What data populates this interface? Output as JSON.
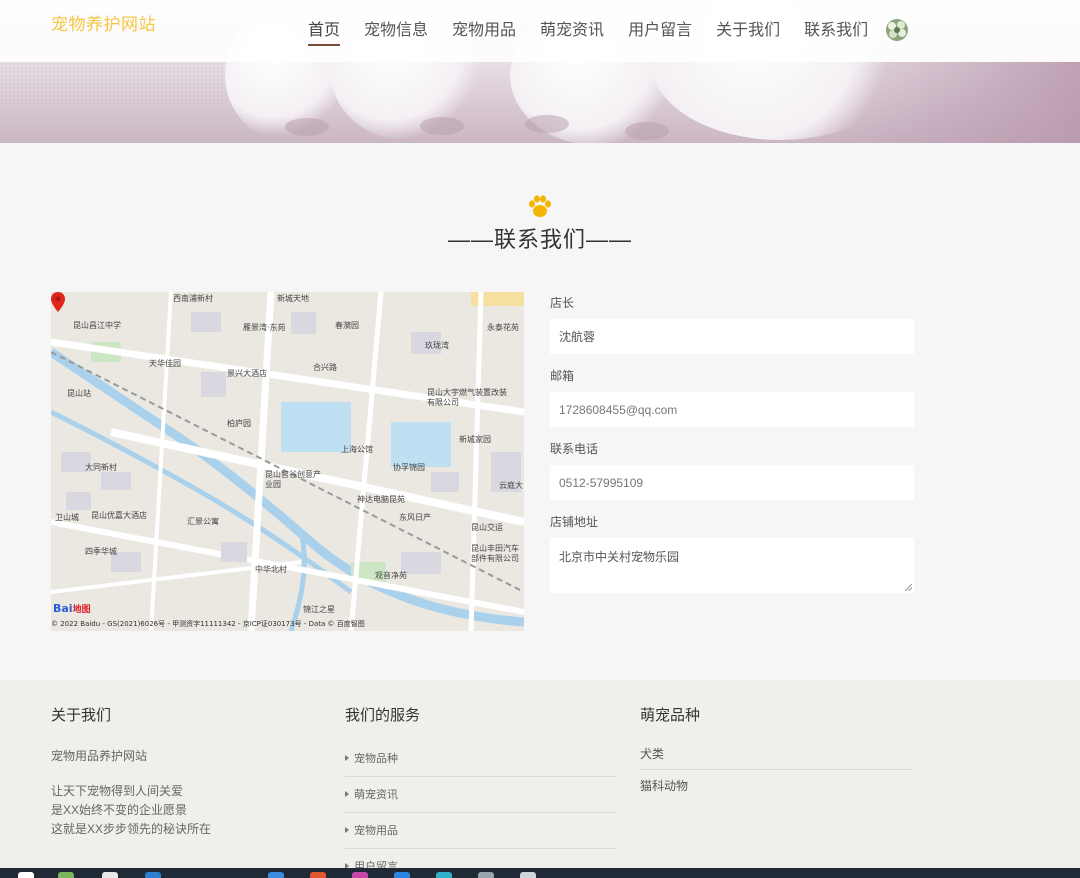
{
  "header": {
    "logo": "宠物养护网站",
    "nav": [
      {
        "label": "首页",
        "active": true
      },
      {
        "label": "宠物信息"
      },
      {
        "label": "宠物用品"
      },
      {
        "label": "萌宠资讯"
      },
      {
        "label": "用户留言"
      },
      {
        "label": "关于我们"
      },
      {
        "label": "联系我们"
      }
    ]
  },
  "section": {
    "title": "——联系我们——"
  },
  "map": {
    "labels": [
      "西南浦新村",
      "新城天地",
      "昆山昌江中学",
      "雁景湾·东苑",
      "春漪园",
      "永泰花苑",
      "玖珑湾",
      "天华佳园",
      "合兴路",
      "景兴大酒店",
      "昆山站",
      "昆山大宇燃气装置改装有限公司",
      "柏庐园",
      "新城家园",
      "上海公馆",
      "大同新村",
      "协孚锦园",
      "昆山智谷创意产业园",
      "神达电脑昆苑",
      "云庭大",
      "昆山优嘉大酒店",
      "汇景公寓",
      "东风日产",
      "昆山交运",
      "卫山城",
      "四季华城",
      "昆山丰田汽车部件有限公司",
      "中华北村",
      "观音净苑",
      "锦江之星"
    ],
    "copyright": "© 2022 Baidu - GS(2021)6026号 - 甲测资字11111342 - 京ICP证030173号 - Data © 百度智图",
    "brand": "Bai",
    "brand2": "地图"
  },
  "form": {
    "owner_label": "店长",
    "owner_value": "沈航蓉",
    "email_label": "邮箱",
    "email_value": "1728608455@qq.com",
    "phone_label": "联系电话",
    "phone_value": "0512-57995109",
    "address_label": "店铺地址",
    "address_value": "北京市中关村宠物乐园"
  },
  "footer": {
    "about_title": "关于我们",
    "about_name": "宠物用品养护网站",
    "about_lines": [
      "让天下宠物得到人间关爱",
      "是XX始终不变的企业愿景",
      "这就是XX步步领先的秘诀所在"
    ],
    "services_title": "我们的服务",
    "services": [
      "宠物品种",
      "萌宠资讯",
      "宠物用品",
      "用户留言"
    ],
    "breeds_title": "萌宠品种",
    "breeds": [
      "犬类",
      "猫科动物"
    ]
  },
  "colors": {
    "logo": "#f5c542",
    "accent_underline": "#7b4b3a",
    "paw": "#f5b400",
    "footer_bg": "#f0efec"
  }
}
